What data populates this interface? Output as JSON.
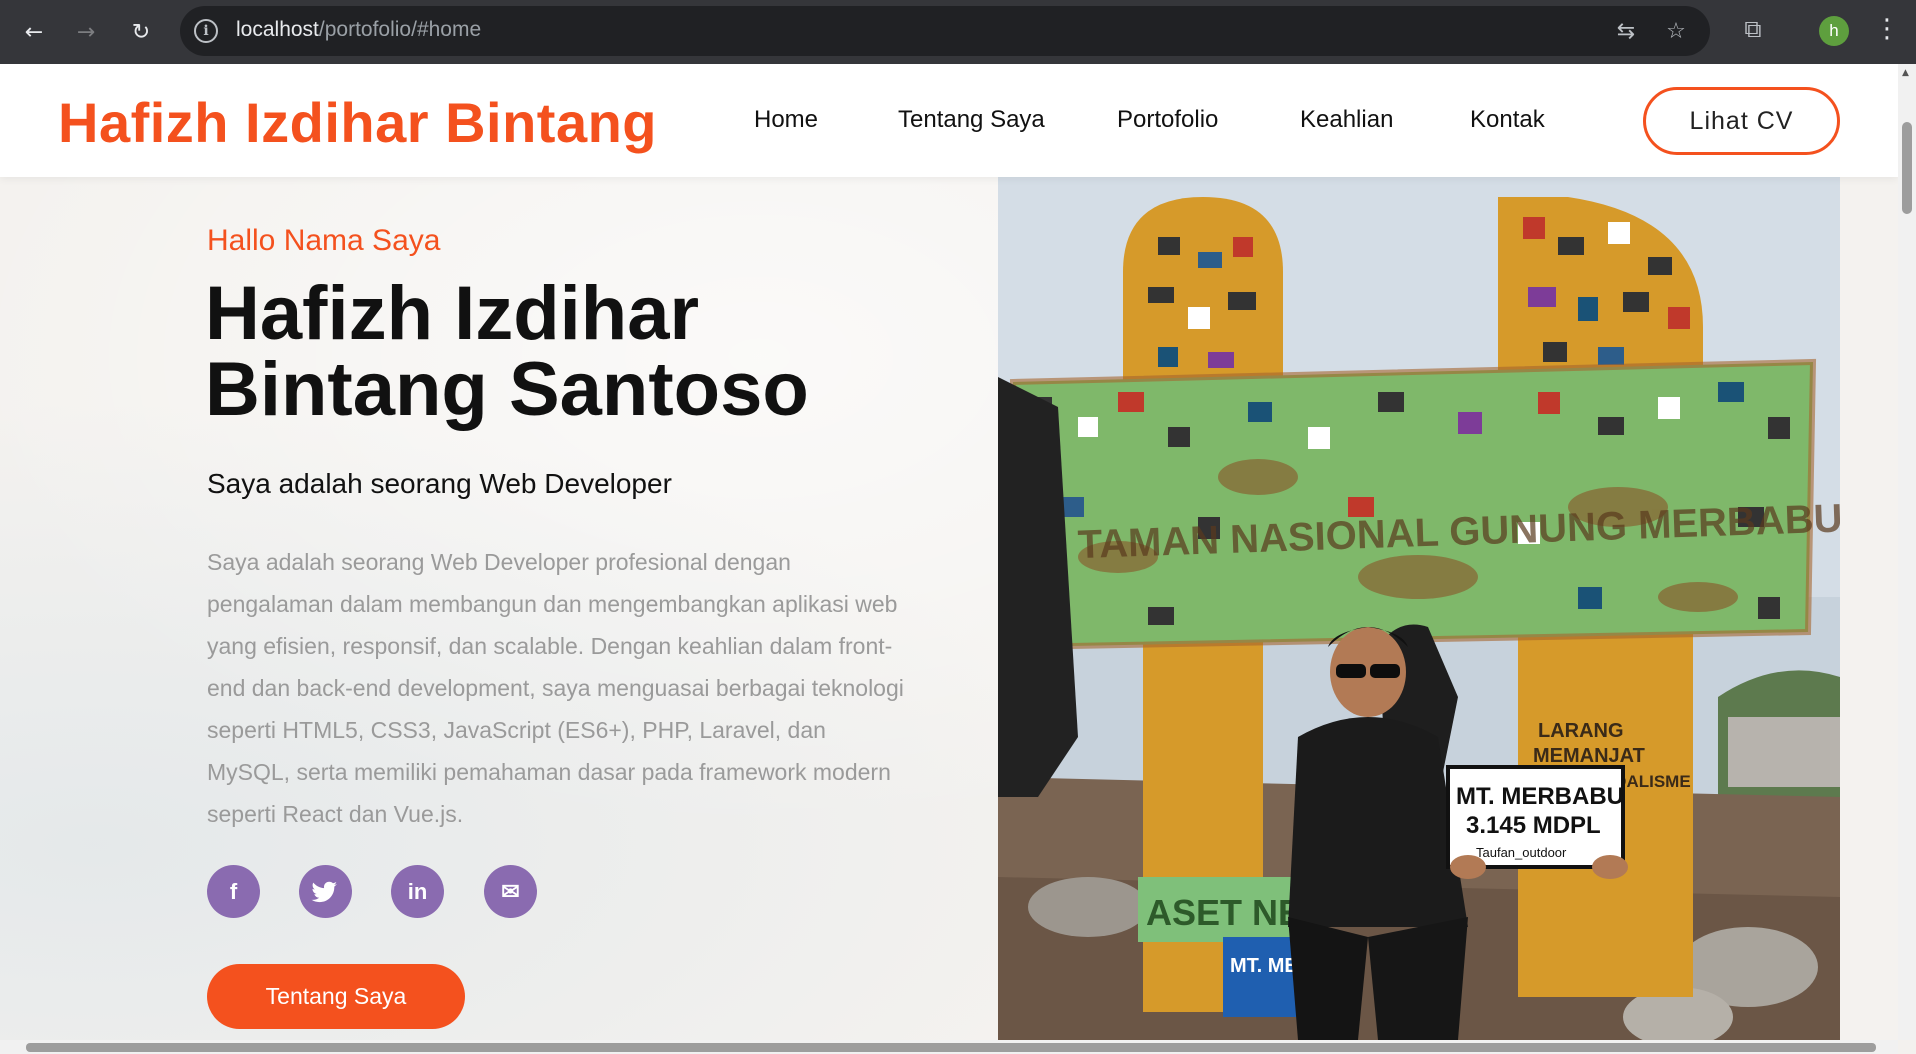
{
  "browser": {
    "url_host": "localhost",
    "url_path": "/portofolio/#home",
    "profile_initial": "h"
  },
  "header": {
    "brand": "Hafizh Izdihar Bintang",
    "nav": [
      "Home",
      "Tentang Saya",
      "Portofolio",
      "Keahlian",
      "Kontak"
    ],
    "cv_button": "Lihat CV"
  },
  "hero": {
    "greeting": "Hallo Nama Saya",
    "name_line1": "Hafizh Izdihar",
    "name_line2": "Bintang Santoso",
    "role": "Saya adalah seorang Web Developer",
    "about": "Saya adalah seorang Web Developer profesional dengan pengalaman dalam membangun dan mengembangkan aplikasi web yang efisien, responsif, dan scalable. Dengan keahlian dalam front-end dan back-end development, saya menguasai berbagai teknologi seperti HTML5, CSS3, JavaScript (ES6+), PHP, Laravel, dan MySQL, serta memiliki pemahaman dasar pada framework modern seperti React dan Vue.js.",
    "socials": [
      {
        "icon": "facebook-icon",
        "glyph": "f"
      },
      {
        "icon": "twitter-icon",
        "glyph": "🐦"
      },
      {
        "icon": "linkedin-icon",
        "glyph": "in"
      },
      {
        "icon": "mail-icon",
        "glyph": "✉"
      }
    ],
    "about_button": "Tentang Saya"
  },
  "photo": {
    "sign_board": "MT. MERBABU",
    "sign_height": "3.145 MDPL",
    "sign_handle": "Taufan_outdoor",
    "plate_warning_1": "LARANG",
    "plate_warning_2": "MEMANJAT",
    "plate_warning_3": "DAN VANDALISME",
    "plate_green_text": "TAMAN NASIONAL GUNUNG MERBABU",
    "plate_aset": "ASET NEG",
    "blue_sign": "MT. MERBA"
  },
  "colors": {
    "accent": "#f4511e",
    "social": "#8a6bb0"
  }
}
